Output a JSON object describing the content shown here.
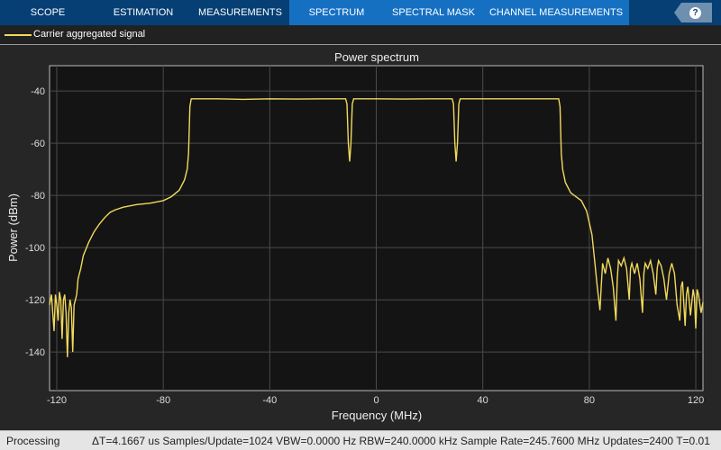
{
  "tabs": [
    {
      "label": "SCOPE",
      "active": false
    },
    {
      "label": "ESTIMATION",
      "active": false
    },
    {
      "label": "MEASUREMENTS",
      "active": false
    },
    {
      "label": "SPECTRUM",
      "active": true
    },
    {
      "label": "SPECTRAL MASK",
      "active": true
    },
    {
      "label": "CHANNEL MEASUREMENTS",
      "active": true
    }
  ],
  "help": {
    "icon": "help-icon",
    "label": "?"
  },
  "legend": {
    "label": "Carrier aggregated signal",
    "color": "#f2d95c"
  },
  "status": {
    "state": "Processing",
    "items": "ΔT=4.1667 us  Samples/Update=1024  VBW=0.0000 Hz  RBW=240.0000 kHz  Sample Rate=245.7600 MHz  Updates=2400  T=0.01"
  },
  "chart_data": {
    "type": "line",
    "title": "Power spectrum",
    "xlabel": "Frequency (MHz)",
    "ylabel": "Power (dBm)",
    "xlim": [
      -122.7,
      122.7
    ],
    "ylim": [
      -154.8,
      -30.3
    ],
    "xticks": [
      -120,
      -80,
      -40,
      0,
      40,
      80,
      120
    ],
    "yticks": [
      -40,
      -60,
      -80,
      -100,
      -120,
      -140
    ],
    "grid": true,
    "series": [
      {
        "name": "Carrier aggregated signal",
        "color": "#f2d95c",
        "x": [
          -122.7,
          -122,
          -121.5,
          -121,
          -120.5,
          -120,
          -119.5,
          -119,
          -118.5,
          -118,
          -117.5,
          -117,
          -116.5,
          -116,
          -115.5,
          -115,
          -114.5,
          -114,
          -113.5,
          -113,
          -112.5,
          -112,
          -111,
          -110,
          -108,
          -106,
          -104,
          -102,
          -100,
          -98,
          -95,
          -90,
          -85,
          -80,
          -77,
          -74,
          -72,
          -71,
          -70.5,
          -70,
          -69.5,
          -60,
          -50,
          -40,
          -30,
          -20,
          -11.5,
          -11,
          -10.5,
          -10,
          -9.5,
          -9,
          -8.5,
          0,
          10,
          20,
          28.5,
          29,
          29.5,
          30,
          30.5,
          31,
          31.5,
          40,
          50,
          60,
          68.5,
          69,
          69.5,
          70,
          71,
          73,
          75,
          77,
          79,
          81,
          82,
          83,
          84,
          84.5,
          85,
          86,
          87,
          88,
          89,
          90,
          90.5,
          91,
          92,
          93,
          94,
          95,
          95.5,
          96,
          97,
          98,
          99,
          100,
          100.5,
          101,
          102,
          103,
          104,
          105,
          105.5,
          106,
          107,
          108,
          109,
          110,
          111,
          112,
          113,
          114,
          114.5,
          115,
          116,
          116.5,
          117,
          117.5,
          118,
          119,
          119.5,
          120,
          120.5,
          121,
          122,
          122.7
        ],
        "y": [
          -122,
          -118,
          -125,
          -132,
          -118,
          -122,
          -128,
          -117,
          -120,
          -135,
          -120,
          -118,
          -125,
          -142,
          -125,
          -120,
          -123,
          -140,
          -122,
          -120,
          -118,
          -112,
          -108,
          -103,
          -98,
          -94,
          -91,
          -88.5,
          -86.5,
          -85.5,
          -84.5,
          -83.5,
          -83,
          -82,
          -80.5,
          -78,
          -74,
          -70,
          -64,
          -46,
          -43,
          -43,
          -43.2,
          -43,
          -43.1,
          -43,
          -43,
          -45,
          -60,
          -67,
          -60,
          -45,
          -43,
          -43,
          -43.1,
          -43,
          -43,
          -45,
          -60,
          -67,
          -60,
          -45,
          -43,
          -43,
          -43,
          -43,
          -43,
          -46,
          -64,
          -70,
          -75,
          -79,
          -80.5,
          -82,
          -86,
          -95,
          -105,
          -115,
          -124,
          -115,
          -106,
          -110,
          -104,
          -108,
          -115,
          -128,
          -112,
          -105,
          -107,
          -104,
          -108,
          -120,
          -108,
          -106,
          -110,
          -106,
          -112,
          -125,
          -110,
          -106,
          -108,
          -105,
          -110,
          -118,
          -108,
          -105,
          -107,
          -112,
          -120,
          -110,
          -106,
          -110,
          -122,
          -128,
          -115,
          -113,
          -130,
          -118,
          -115,
          -120,
          -126,
          -116,
          -119,
          -131,
          -116,
          -118,
          -125,
          -121
        ]
      }
    ]
  }
}
